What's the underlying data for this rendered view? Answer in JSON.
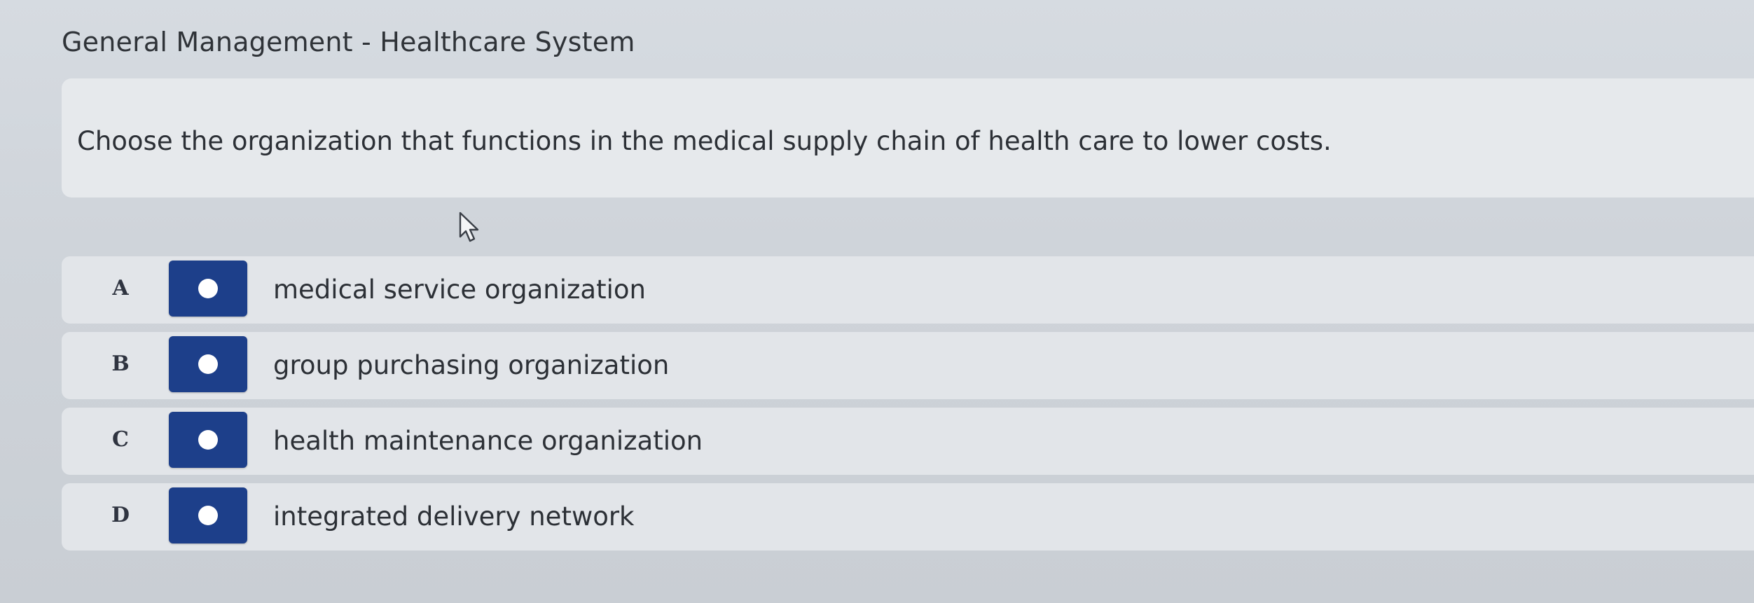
{
  "page": {
    "title": "General Management - Healthcare System"
  },
  "question": {
    "text": "Choose the organization that functions in the medical supply chain of health care to lower costs."
  },
  "options": [
    {
      "letter": "A",
      "text": "medical service organization"
    },
    {
      "letter": "B",
      "text": "group purchasing organization"
    },
    {
      "letter": "C",
      "text": "health maintenance organization"
    },
    {
      "letter": "D",
      "text": "integrated delivery network"
    }
  ],
  "colors": {
    "radio_background": "#1d3f8a",
    "radio_dot": "#ffffff",
    "panel_background": "#e6e9ec"
  },
  "icons": {
    "cursor": "mouse-pointer-icon",
    "radio": "radio-dot-icon"
  }
}
